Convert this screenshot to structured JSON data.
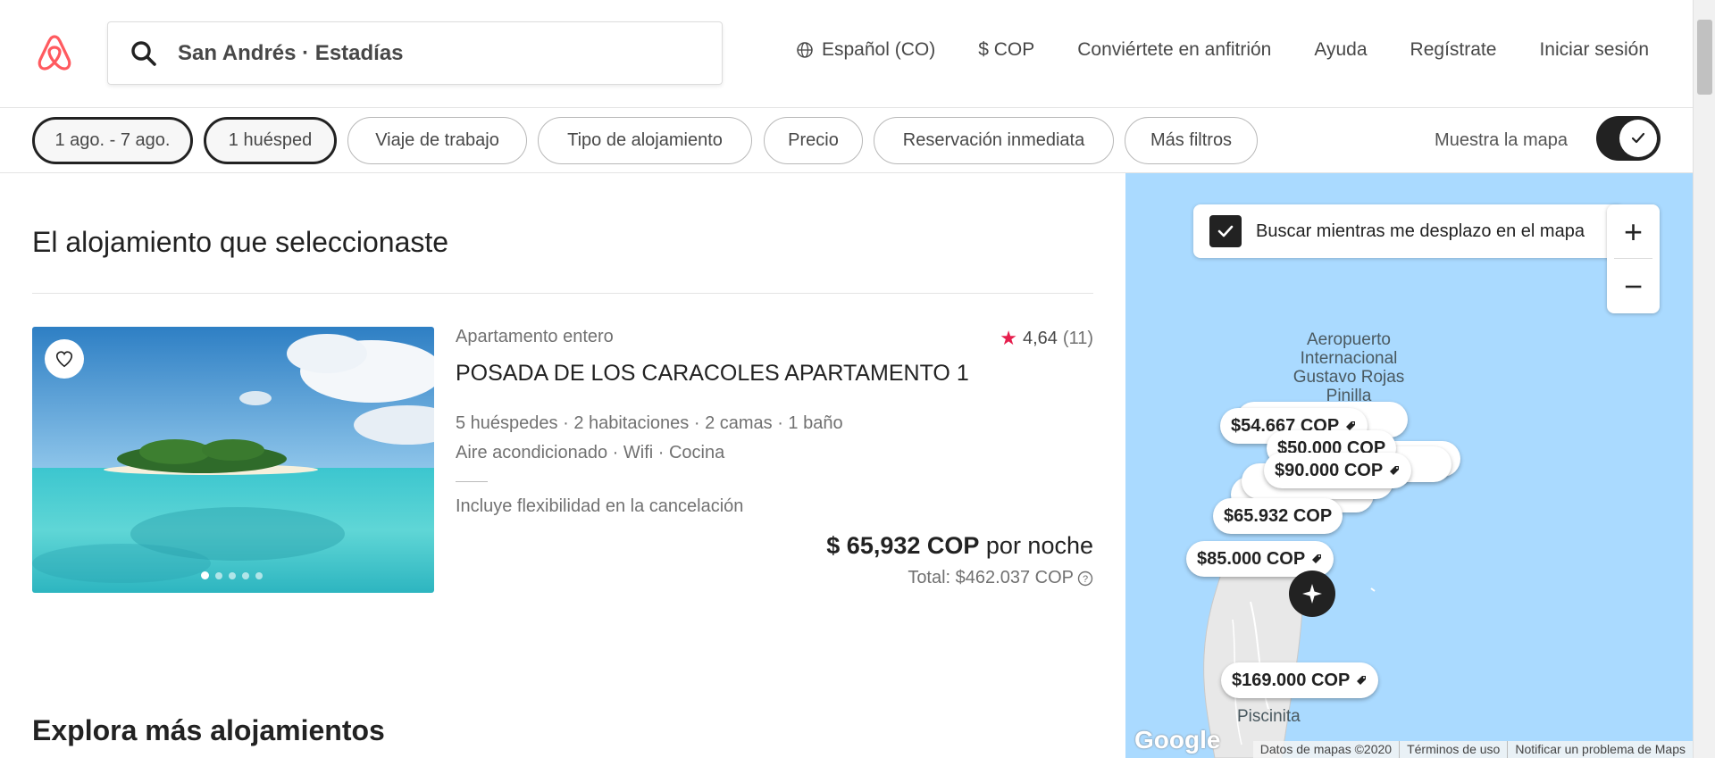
{
  "header": {
    "search_text": "San Andrés · Estadías",
    "nav": {
      "language": "Español (CO)",
      "currency": "$ COP",
      "host": "Conviértete en anfitrión",
      "help": "Ayuda",
      "signup": "Regístrate",
      "login": "Iniciar sesión"
    }
  },
  "filters": {
    "dates": "1 ago. - 7 ago.",
    "guests": "1 huésped",
    "work_trip": "Viaje de trabajo",
    "type": "Tipo de alojamiento",
    "price": "Precio",
    "instant": "Reservación inmediata",
    "more": "Más filtros",
    "show_map_label": "Muestra la mapa",
    "show_map_on": true
  },
  "selected_section": {
    "heading": "El alojamiento que seleccionaste",
    "listing": {
      "type": "Apartamento entero",
      "rating": "4,64",
      "reviews": "(11)",
      "title": "POSADA DE LOS CARACOLES APARTAMENTO 1",
      "capacity": "5 huéspedes · 2 habitaciones · 2 camas · 1 baño",
      "amenities": "Aire acondicionado · Wifi · Cocina",
      "flex": "Incluye flexibilidad en la cancelación",
      "price": "$ 65,932 COP",
      "per_night": " por noche",
      "total": "Total: $462.037  COP",
      "photo_count": 5,
      "photo_index": 0
    }
  },
  "explore_heading": "Explora más alojamientos",
  "map": {
    "search_while_moving": "Buscar mientras me desplazo en el mapa",
    "search_while_moving_checked": true,
    "zoom_in": "+",
    "zoom_out": "−",
    "airport_label": "Aeropuerto Internacional Gustavo Rojas Pinilla",
    "place_label": "Piscinita",
    "pins": {
      "p1": "$54.667  COP",
      "p2": "$50.000  COP",
      "p3": "$90.000  COP",
      "p4": "$65.932  COP",
      "p5": "$85.000  COP",
      "p6": "$169.000  COP"
    },
    "google": "Google",
    "attribution": {
      "data": "Datos de mapas ©2020",
      "terms": "Términos de uso",
      "report": "Notificar un problema de Maps"
    },
    "colors": {
      "water": "#aadaff",
      "land": "#e8e8e8",
      "pin_bg": "#ffffff",
      "selected_pin": "#222222"
    }
  },
  "colors": {
    "brand": "#ff5a5f",
    "star": "#e61e4d",
    "text": "#222222",
    "muted": "#717171"
  },
  "icons": {
    "logo": "airbnb-logo",
    "search": "search-icon",
    "globe": "globe-icon",
    "heart": "heart-icon",
    "check": "check-icon",
    "star": "star-icon",
    "question": "question-icon",
    "tag": "tag-icon",
    "sparkle": "sparkle-icon"
  }
}
